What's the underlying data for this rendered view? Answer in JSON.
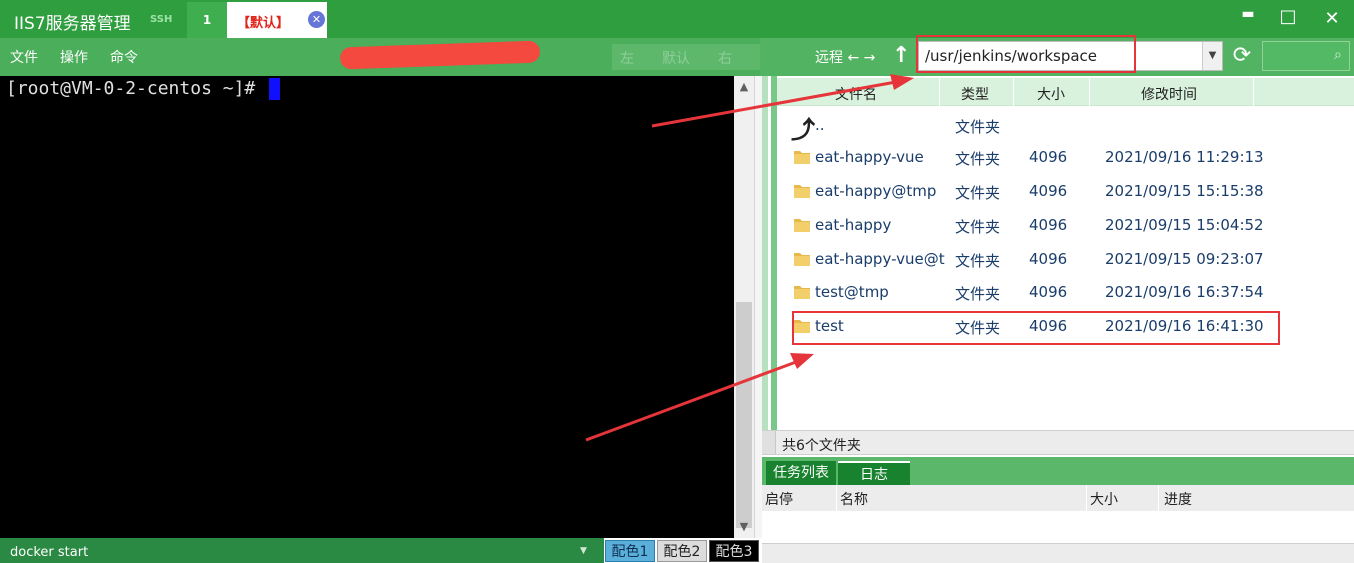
{
  "app": {
    "title": "IIS7服务器管理",
    "window_buttons": {
      "minimize": "▬",
      "maximize": "□",
      "close": "✕"
    }
  },
  "tabs": {
    "ssh_label": "SSH",
    "number_label": "1",
    "default_label": "【默认】",
    "close_icon": "✕"
  },
  "menu": {
    "file": "文件",
    "operate": "操作",
    "command": "命令"
  },
  "align": {
    "left": "左",
    "default": "默认",
    "right": "右"
  },
  "remote": {
    "label": "远程 ← →",
    "path": "/usr/jenkins/workspace",
    "dropdown_icon": "▼",
    "up_icon": "↑",
    "refresh_icon": "⟳",
    "search_icon": "⌕"
  },
  "terminal": {
    "prompt": "[root@VM-0-2-centos ~]#",
    "status_text": "docker start",
    "status_dropdown_icon": "▼",
    "scroll_up_icon": "▲",
    "scroll_down_icon": "▼",
    "color_schemes": [
      "配色1",
      "配色2",
      "配色3"
    ]
  },
  "file_list": {
    "columns": [
      "文件名",
      "类型",
      "大小",
      "修改时间"
    ],
    "parent": {
      "name": "..",
      "type": "文件夹"
    },
    "rows": [
      {
        "name": "eat-happy-vue",
        "type": "文件夹",
        "size": "4096",
        "modified": "2021/09/16 11:29:13"
      },
      {
        "name": "eat-happy@tmp",
        "type": "文件夹",
        "size": "4096",
        "modified": "2021/09/15 15:15:38"
      },
      {
        "name": "eat-happy",
        "type": "文件夹",
        "size": "4096",
        "modified": "2021/09/15 15:04:52"
      },
      {
        "name": "eat-happy-vue@t",
        "type": "文件夹",
        "size": "4096",
        "modified": "2021/09/15 09:23:07"
      },
      {
        "name": "test@tmp",
        "type": "文件夹",
        "size": "4096",
        "modified": "2021/09/16 16:37:54"
      },
      {
        "name": "test",
        "type": "文件夹",
        "size": "4096",
        "modified": "2021/09/16 16:41:30"
      }
    ],
    "status": "共6个文件夹"
  },
  "tasks": {
    "tabs": [
      "任务列表",
      "日志"
    ],
    "columns": [
      "启停",
      "名称",
      "大小",
      "进度"
    ]
  },
  "colors": {
    "title_green": "#2f9e3f",
    "toolbar_green": "#4aae5a",
    "highlight_red": "#e5353a",
    "cursor_blue": "#1010ff"
  }
}
